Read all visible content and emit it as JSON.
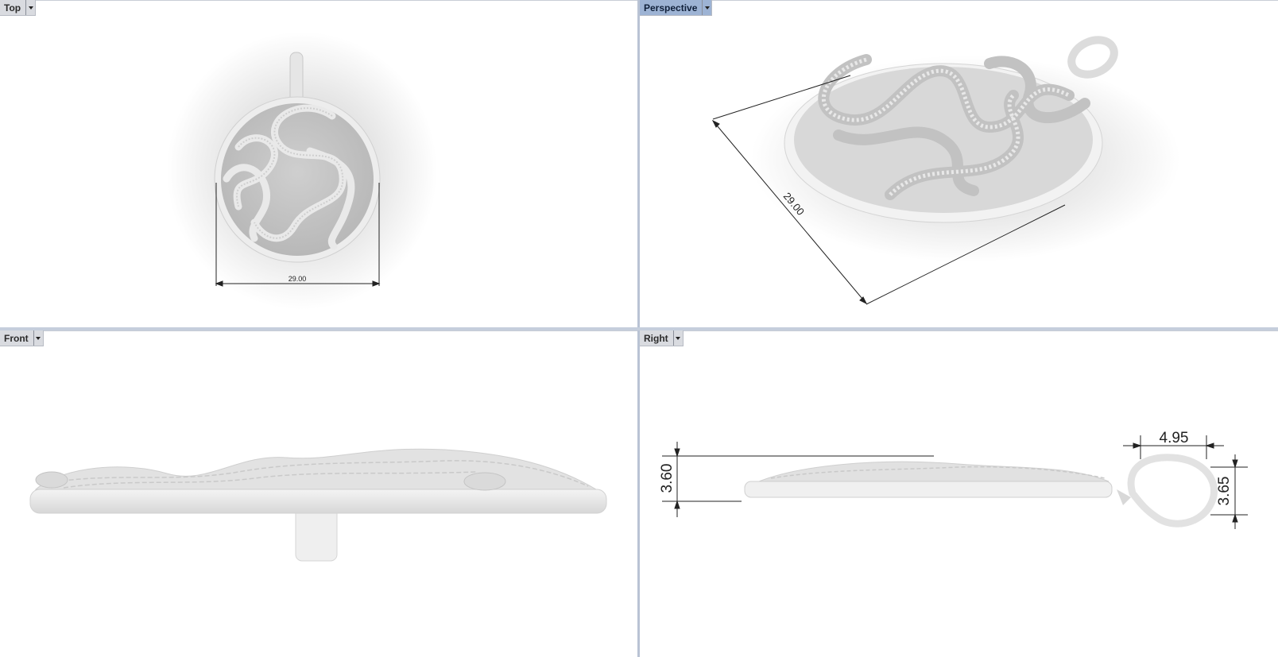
{
  "viewports": {
    "top": {
      "label": "Top",
      "dimension": "29.00"
    },
    "perspective": {
      "label": "Perspective",
      "dimension": "29.00"
    },
    "front": {
      "label": "Front"
    },
    "right": {
      "label": "Right",
      "dim_loop_width": "4.95",
      "dim_height": "3.60",
      "dim_loop_height": "3.65"
    }
  },
  "colors": {
    "active_tab": "#9db3d4",
    "inactive_tab": "#d9dbe0",
    "divider": "#b9c3d4"
  }
}
